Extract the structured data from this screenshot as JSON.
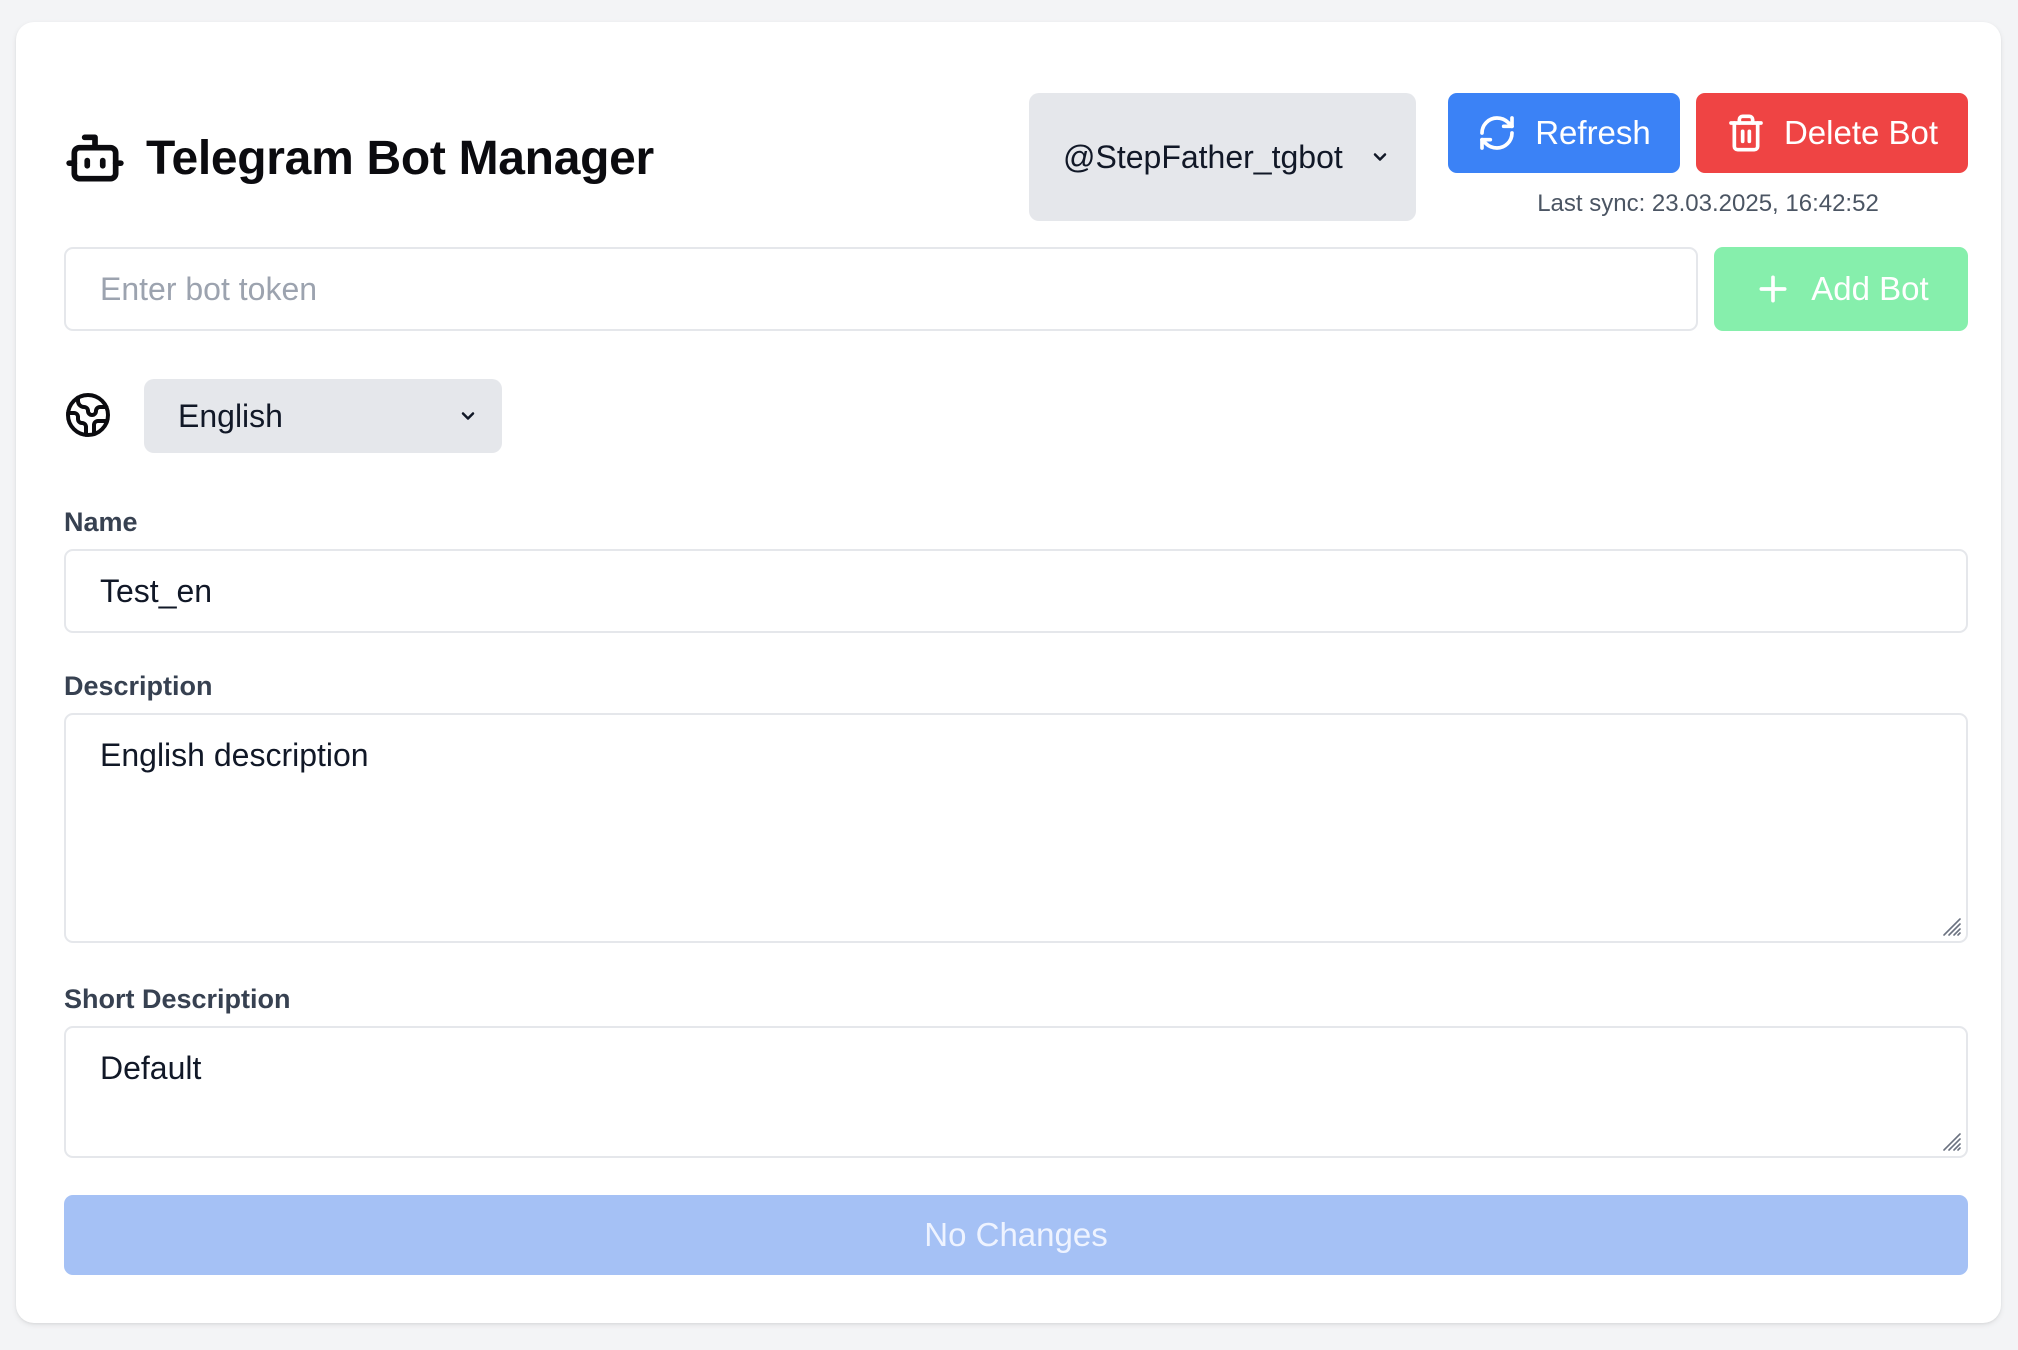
{
  "header": {
    "title": "Telegram Bot Manager",
    "icon": "robot-icon",
    "selected_bot": "@StepFather_tgbot",
    "refresh_label": "Refresh",
    "delete_label": "Delete Bot",
    "last_sync": "Last sync: 23.03.2025, 16:42:52"
  },
  "add_bot": {
    "placeholder": "Enter bot token",
    "value": "",
    "button_label": "Add Bot"
  },
  "language": {
    "icon": "globe-icon",
    "selected": "English"
  },
  "form": {
    "name_label": "Name",
    "name_value": "Test_en",
    "description_label": "Description",
    "description_value": "English description",
    "short_description_label": "Short Description",
    "short_description_value": "Default"
  },
  "save_button_label": "No Changes",
  "colors": {
    "primary": "#3b82f6",
    "danger": "#ef4444",
    "success_disabled": "#86efac",
    "primary_disabled": "#a5c1f5",
    "page_bg": "#f3f4f6"
  }
}
